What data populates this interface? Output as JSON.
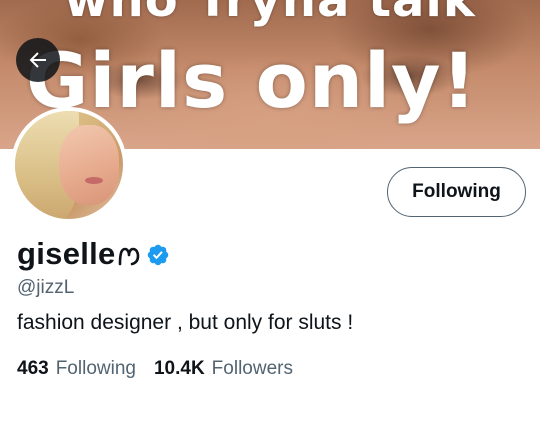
{
  "banner": {
    "text_top": "who Tryna talk",
    "text_main": "Girls only!"
  },
  "icons": {
    "back": "arrow-left-icon",
    "verified": "verified-badge-icon",
    "name_emoji": "heart-icon"
  },
  "colors": {
    "verified": "#1d9bf0",
    "text_primary": "#0f1419",
    "text_secondary": "#536471",
    "button_border": "#536471"
  },
  "profile": {
    "display_name": "giselle",
    "handle": "@jizzL",
    "bio": "fashion designer , but only for sluts !",
    "follow_button_label": "Following",
    "following_count": "463",
    "following_label": "Following",
    "followers_count": "10.4K",
    "followers_label": "Followers"
  }
}
